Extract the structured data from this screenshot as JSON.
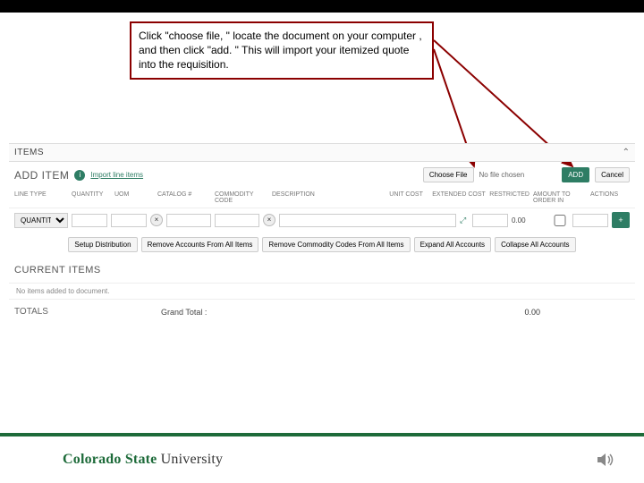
{
  "callout": {
    "text": "Click \"choose file, \" locate the document on your computer , and then click \"add. \"  This will import your itemized quote into the requisition."
  },
  "items": {
    "header": "ITEMS",
    "add_label": "ADD ITEM",
    "import_link": "Import line items",
    "choose_file_btn": "Choose File",
    "no_file": "No file chosen",
    "add_btn": "ADD",
    "cancel_btn": "Cancel",
    "cols": {
      "linetype": "LINE TYPE",
      "quantity": "QUANTITY",
      "uom": "UOM",
      "catalog": "CATALOG #",
      "comm": "COMMODITY CODE",
      "desc": "DESCRIPTION",
      "unit": "UNIT COST",
      "ext": "EXTENDED COST",
      "rest": "RESTRICTED",
      "amt": "AMOUNT TO ORDER IN",
      "act": "ACTIONS"
    },
    "line": {
      "type_selected": "QUANTITY",
      "ext_value": "0.00"
    },
    "actions": {
      "setup": "Setup Distribution",
      "remove_acct": "Remove Accounts From All Items",
      "remove_comm": "Remove Commodity Codes From All Items",
      "expand": "Expand All Accounts",
      "collapse": "Collapse All Accounts"
    }
  },
  "current": {
    "header": "CURRENT ITEMS",
    "empty": "No items added to document."
  },
  "totals": {
    "label": "TOTALS",
    "grand_label": "Grand Total :",
    "grand_value": "0.00"
  },
  "footer": {
    "logo1": "Colorado",
    "logo2": "State",
    "logo3": "University"
  }
}
